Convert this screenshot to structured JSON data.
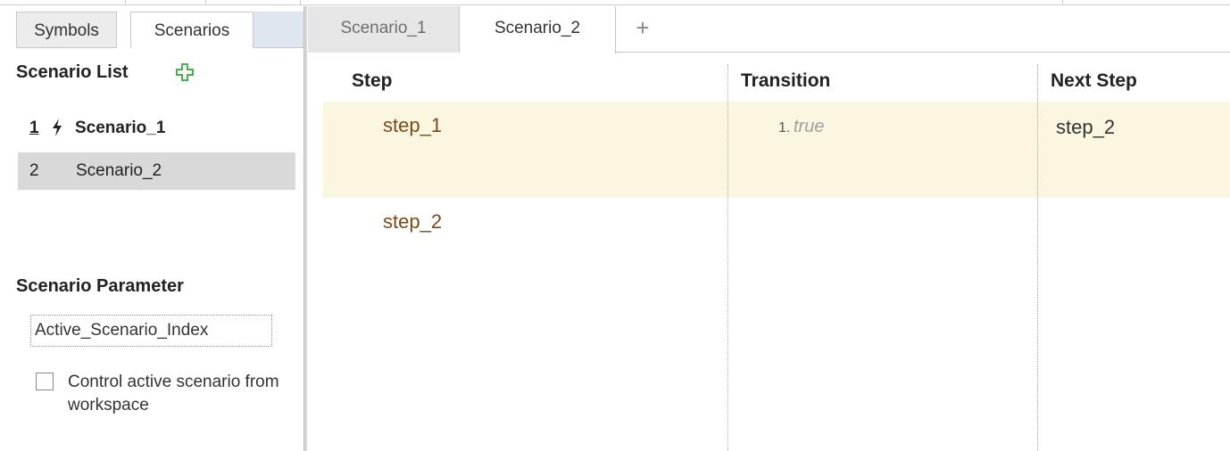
{
  "left_tabs": {
    "symbols": "Symbols",
    "scenarios": "Scenarios"
  },
  "scenario_list": {
    "title": "Scenario List",
    "items": [
      {
        "number": "1",
        "name": "Scenario_1",
        "active": true
      },
      {
        "number": "2",
        "name": "Scenario_2",
        "active": false
      }
    ]
  },
  "scenario_parameter": {
    "title": "Scenario Parameter",
    "value": "Active_Scenario_Index",
    "checkbox_label": "Control active scenario from workspace",
    "checkbox_checked": false
  },
  "right_tabs": {
    "tabs": [
      "Scenario_1",
      "Scenario_2"
    ],
    "selected": "Scenario_2",
    "add": "+"
  },
  "grid": {
    "headers": {
      "step": "Step",
      "transition": "Transition",
      "next_step": "Next Step"
    },
    "rows": [
      {
        "step": "step_1",
        "transition_number": "1.",
        "transition_condition": "true",
        "next_step": "step_2"
      },
      {
        "step": "step_2",
        "transition_number": "",
        "transition_condition": "",
        "next_step": ""
      }
    ]
  },
  "colors": {
    "highlight_row": "#fbf6e0",
    "step_text": "#7b4a1a",
    "add_icon": "#4caf50",
    "selected_item": "#d9d9d9"
  }
}
